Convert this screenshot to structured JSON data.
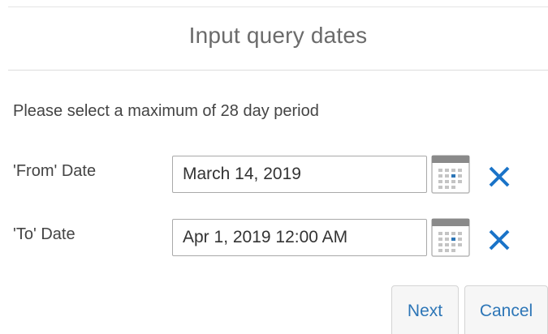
{
  "dialog": {
    "title": "Input query dates",
    "instruction": "Please select a maximum of 28 day period"
  },
  "from_date": {
    "label": "'From' Date",
    "value": "March 14, 2019",
    "calendar_icon": "calendar-icon",
    "clear_icon": "close-icon"
  },
  "to_date": {
    "label": "'To' Date",
    "value": "Apr 1, 2019 12:00 AM",
    "calendar_icon": "calendar-icon",
    "clear_icon": "close-icon"
  },
  "buttons": {
    "next_label": "Next",
    "cancel_label": "Cancel"
  },
  "colors": {
    "accent": "#2d76b7",
    "clear_icon": "#1a73c8",
    "text": "#444444"
  }
}
